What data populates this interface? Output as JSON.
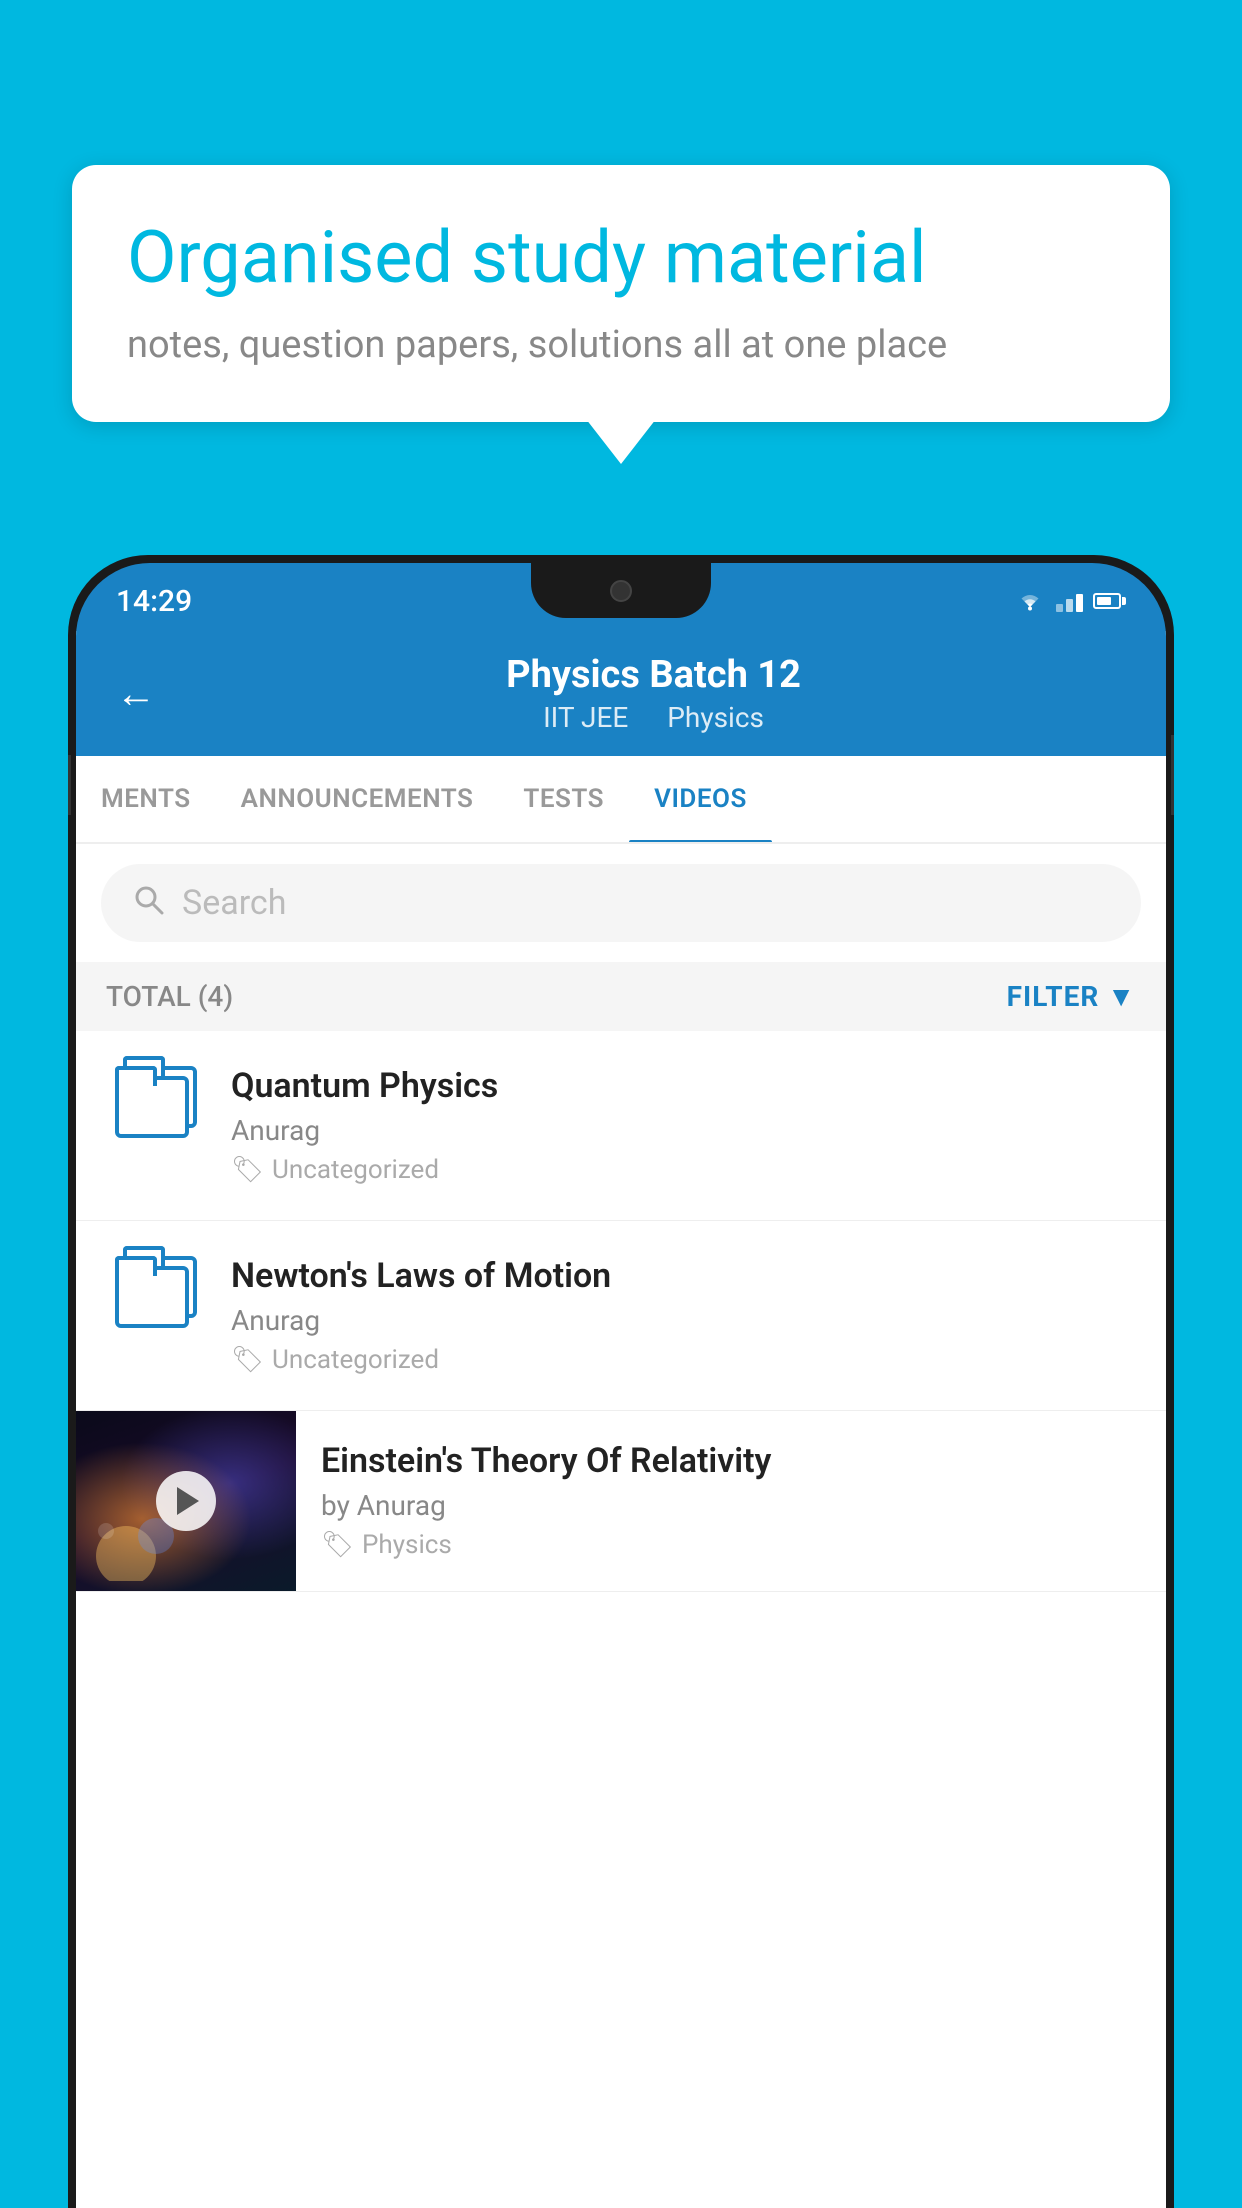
{
  "background_color": "#00b8e0",
  "speech_bubble": {
    "title": "Organised study material",
    "subtitle": "notes, question papers, solutions all at one place"
  },
  "phone": {
    "status_bar": {
      "time": "14:29"
    },
    "header": {
      "back_label": "←",
      "title": "Physics Batch 12",
      "tag1": "IIT JEE",
      "tag2": "Physics"
    },
    "tabs": [
      {
        "label": "MENTS",
        "active": false
      },
      {
        "label": "ANNOUNCEMENTS",
        "active": false
      },
      {
        "label": "TESTS",
        "active": false
      },
      {
        "label": "VIDEOS",
        "active": true
      }
    ],
    "search": {
      "placeholder": "Search"
    },
    "filter_row": {
      "total_label": "TOTAL (4)",
      "filter_label": "FILTER"
    },
    "videos": [
      {
        "id": 1,
        "title": "Quantum Physics",
        "author": "Anurag",
        "tag": "Uncategorized",
        "has_thumbnail": false
      },
      {
        "id": 2,
        "title": "Newton's Laws of Motion",
        "author": "Anurag",
        "tag": "Uncategorized",
        "has_thumbnail": false
      },
      {
        "id": 3,
        "title": "Einstein's Theory Of Relativity",
        "author": "by Anurag",
        "tag": "Physics",
        "has_thumbnail": true
      }
    ]
  }
}
